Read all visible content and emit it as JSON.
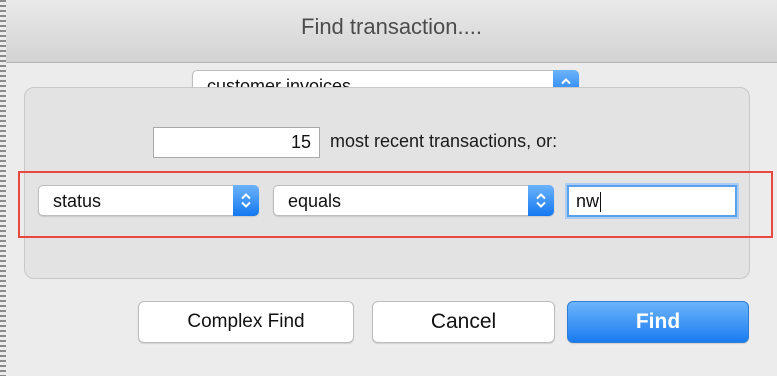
{
  "window": {
    "title": "Find transaction...."
  },
  "transaction_type": {
    "selected": "customer invoices"
  },
  "recent": {
    "count": "15",
    "label": "most recent transactions, or:"
  },
  "criteria": {
    "field": "status",
    "operator": "equals",
    "value": "nw"
  },
  "buttons": {
    "complex_find": "Complex Find",
    "cancel": "Cancel",
    "find": "Find"
  },
  "colors": {
    "accent": "#1a7cf0",
    "highlight_border": "#e8483f",
    "focus_ring": "#5aa0ec"
  },
  "icons": {
    "popup_stepper": "up-down-arrows-icon"
  }
}
